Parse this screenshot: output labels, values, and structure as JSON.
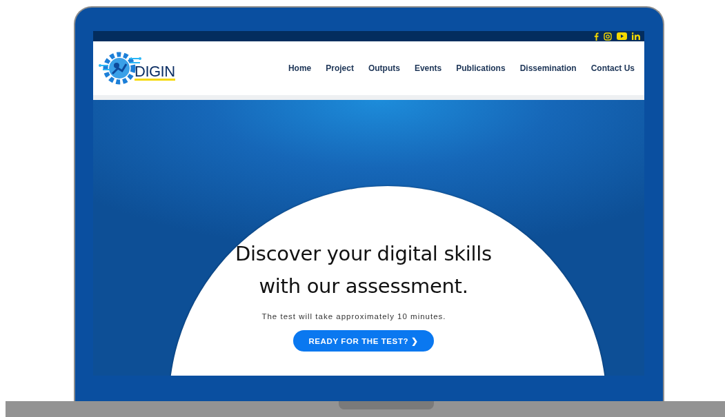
{
  "logo": {
    "text": "DIGIN"
  },
  "nav": [
    {
      "label": "Home"
    },
    {
      "label": "Project"
    },
    {
      "label": "Outputs"
    },
    {
      "label": "Events"
    },
    {
      "label": "Publications"
    },
    {
      "label": "Dissemination"
    },
    {
      "label": "Contact Us"
    }
  ],
  "social": [
    {
      "kind": "facebook"
    },
    {
      "kind": "instagram"
    },
    {
      "kind": "youtube"
    },
    {
      "kind": "linkedin"
    }
  ],
  "hero": {
    "heading_lines": [
      "Discover your digital skills",
      "with our assessment."
    ],
    "subtitle": "The test will take approximately 10 minutes.",
    "button": "READY FOR THE TEST?",
    "button_icon": "❯"
  }
}
